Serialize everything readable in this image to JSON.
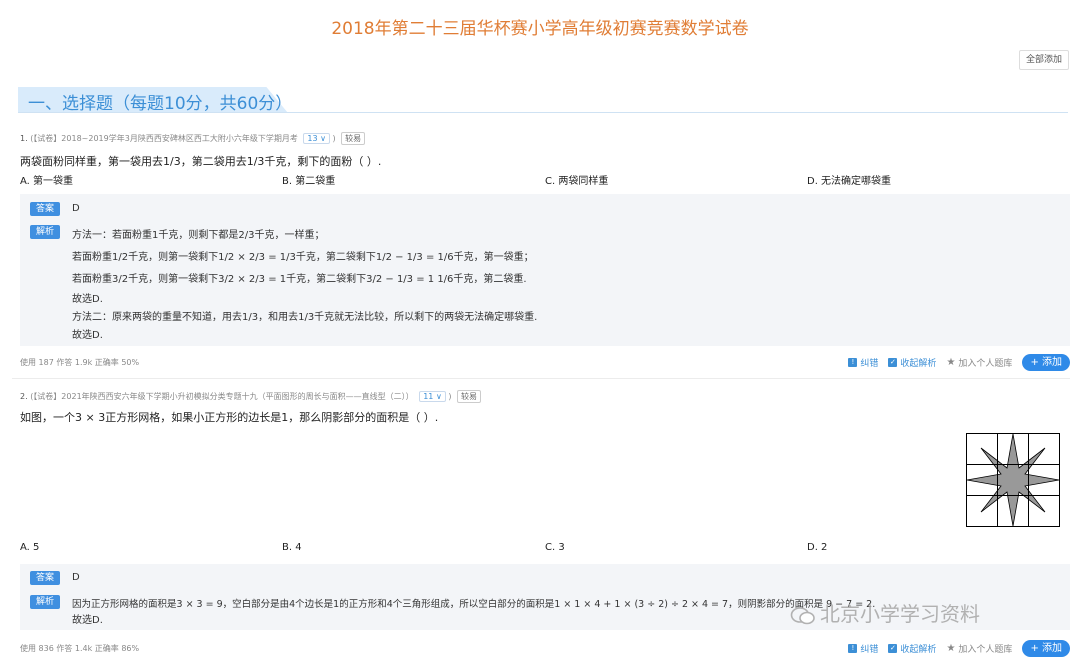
{
  "page": {
    "title": "2018年第二十三届华杯赛小学高年级初赛竞赛数学试卷",
    "add_all_label": "全部添加",
    "section_title": "一、选择题（每题10分，共60分）"
  },
  "questions": [
    {
      "number": "1.",
      "source": "(【试卷】2018~2019学年3月陕西西安碑林区西工大附小六年级下学期月考",
      "chip": "13 ∨",
      "difficulty": "较易",
      "stem": "两袋面粉同样重，第一袋用去1/3，第二袋用去1/3千克，剩下的面粉（    ）.",
      "options": [
        "A. 第一袋重",
        "B. 第二袋重",
        "C. 两袋同样重",
        "D. 无法确定哪袋重"
      ],
      "answer_tag": "答案",
      "answer": "D",
      "analysis_tag": "解析",
      "analysis": [
        "方法一：若面粉重1千克，则剩下都是2/3千克，一样重；",
        "若面粉重1/2千克，则第一袋剩下1/2 × 2/3 = 1/3千克，第二袋剩下1/2 − 1/3 = 1/6千克，第一袋重；",
        "若面粉重3/2千克，则第一袋剩下3/2 × 2/3 = 1千克，第二袋剩下3/2 − 1/3 = 1 1/6千克，第二袋重.",
        "故选D.",
        "方法二：原来两袋的重量不知道，用去1/3，和用去1/3千克就无法比较，所以剩下的两袋无法确定哪袋重.",
        "故选D."
      ],
      "stats": "使用 187   作答 1.9k   正确率 50%"
    },
    {
      "number": "2.",
      "source": "(【试卷】2021年陕西西安六年级下学期小升初模拟分类专题十九（平面图形的周长与面积——直线型（二））",
      "chip": "11 ∨",
      "difficulty": "较易",
      "stem": "如图，一个3 × 3正方形网格，如果小正方形的边长是1，那么阴影部分的面积是（ ）.",
      "options": [
        "A. 5",
        "B. 4",
        "C. 3",
        "D. 2"
      ],
      "answer_tag": "答案",
      "answer": "D",
      "analysis_tag": "解析",
      "analysis": [
        "因为正方形网格的面积是3 × 3 = 9，空白部分是由4个边长是1的正方形和4个三角形组成，所以空白部分的面积是1 × 1 × 4 + 1 × (3 ÷ 2) ÷ 2 × 4 = 7，则阴影部分的面积是 9 − 7 = 2.",
        "故选D."
      ],
      "stats": "使用 836   作答 1.4k   正确率 86%"
    }
  ],
  "actions": {
    "correct": "纠错",
    "collect": "收起解析",
    "personal": "加入个人题库",
    "add": "+ 添加"
  },
  "watermark": "北京小学学习资料",
  "colors": {
    "title": "#e07d35",
    "accent": "#3c8fd6",
    "tag_bg": "#3f8fe0",
    "answer_bg": "#f3f5f8"
  }
}
